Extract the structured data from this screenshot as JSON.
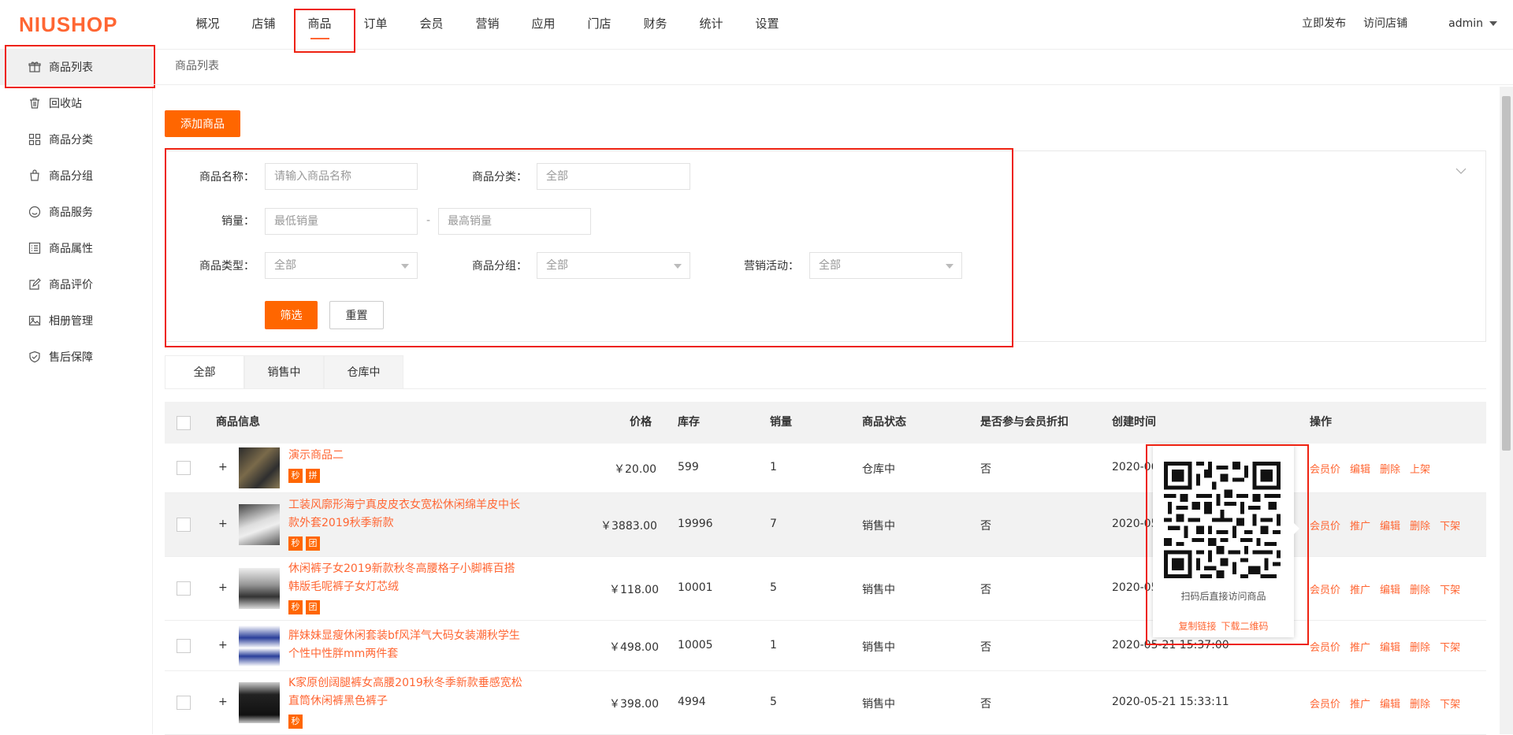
{
  "brand": {
    "logo_text": "NIUSHOP",
    "accent": "#ff6a00"
  },
  "nav": {
    "items": [
      "概况",
      "店铺",
      "商品",
      "订单",
      "会员",
      "营销",
      "应用",
      "门店",
      "财务",
      "统计",
      "设置"
    ],
    "active_index": 2
  },
  "top_right": {
    "publish": "立即发布",
    "visit": "访问店铺",
    "user": "admin"
  },
  "sidebar": {
    "items": [
      {
        "label": "商品列表",
        "icon": "gift-icon"
      },
      {
        "label": "回收站",
        "icon": "trash-icon"
      },
      {
        "label": "商品分类",
        "icon": "grid-icon"
      },
      {
        "label": "商品分组",
        "icon": "bag-icon"
      },
      {
        "label": "商品服务",
        "icon": "smile-icon"
      },
      {
        "label": "商品属性",
        "icon": "list-icon"
      },
      {
        "label": "商品评价",
        "icon": "edit-icon"
      },
      {
        "label": "相册管理",
        "icon": "image-icon"
      },
      {
        "label": "售后保障",
        "icon": "shield-icon"
      }
    ],
    "active_index": 0
  },
  "breadcrumb": "商品列表",
  "add_button": "添加商品",
  "filter": {
    "name_label": "商品名称：",
    "name_placeholder": "请输入商品名称",
    "category_label": "商品分类：",
    "category_value": "全部",
    "sales_label": "销量：",
    "sales_min_placeholder": "最低销量",
    "sales_sep": "-",
    "sales_max_placeholder": "最高销量",
    "type_label": "商品类型：",
    "type_value": "全部",
    "group_label": "商品分组：",
    "group_value": "全部",
    "promo_label": "营销活动：",
    "promo_value": "全部",
    "filter_button": "筛选",
    "reset_button": "重置"
  },
  "tabs": [
    "全部",
    "销售中",
    "仓库中"
  ],
  "table": {
    "headers": {
      "info": "商品信息",
      "price": "价格",
      "stock": "库存",
      "sales": "销量",
      "status": "商品状态",
      "member_discount": "是否参与会员折扣",
      "created": "创建时间",
      "ops": "操作"
    },
    "rows": [
      {
        "name": "演示商品二",
        "tags": [
          "秒",
          "拼"
        ],
        "price": "￥20.00",
        "stock": "599",
        "sales": "1",
        "status": "仓库中",
        "discount": "否",
        "created": "2020-06",
        "ops": [
          "会员价",
          "编辑",
          "删除",
          "上架"
        ]
      },
      {
        "name": "工装风廓形海宁真皮皮衣女宽松休闲绵羊皮中长款外套2019秋季新款",
        "tags": [
          "秒",
          "团"
        ],
        "price": "￥3883.00",
        "stock": "19996",
        "sales": "7",
        "status": "销售中",
        "discount": "否",
        "created": "2020-05",
        "ops": [
          "会员价",
          "推广",
          "编辑",
          "删除",
          "下架"
        ]
      },
      {
        "name": "休闲裤子女2019新款秋冬高腰格子小脚裤百搭韩版毛呢裤子女灯芯绒",
        "tags": [
          "秒",
          "团"
        ],
        "price": "￥118.00",
        "stock": "10001",
        "sales": "5",
        "status": "销售中",
        "discount": "否",
        "created": "2020-05",
        "ops": [
          "会员价",
          "推广",
          "编辑",
          "删除",
          "下架"
        ]
      },
      {
        "name": "胖妹妹显瘦休闲套装bf风洋气大码女装潮秋学生个性中性胖mm两件套",
        "tags": [],
        "price": "￥498.00",
        "stock": "10005",
        "sales": "1",
        "status": "销售中",
        "discount": "否",
        "created": "2020-05-21 15:37:00",
        "ops": [
          "会员价",
          "推广",
          "编辑",
          "删除",
          "下架"
        ]
      },
      {
        "name": "K家原创阔腿裤女高腰2019秋冬季新款垂感宽松直筒休闲裤黑色裤子",
        "tags": [
          "秒"
        ],
        "price": "￥398.00",
        "stock": "4994",
        "sales": "5",
        "status": "销售中",
        "discount": "否",
        "created": "2020-05-21 15:33:11",
        "ops": [
          "会员价",
          "推广",
          "编辑",
          "删除",
          "下架"
        ]
      }
    ]
  },
  "qr_popup": {
    "caption": "扫码后直接访问商品",
    "copy_link": "复制链接",
    "download": "下载二维码"
  }
}
